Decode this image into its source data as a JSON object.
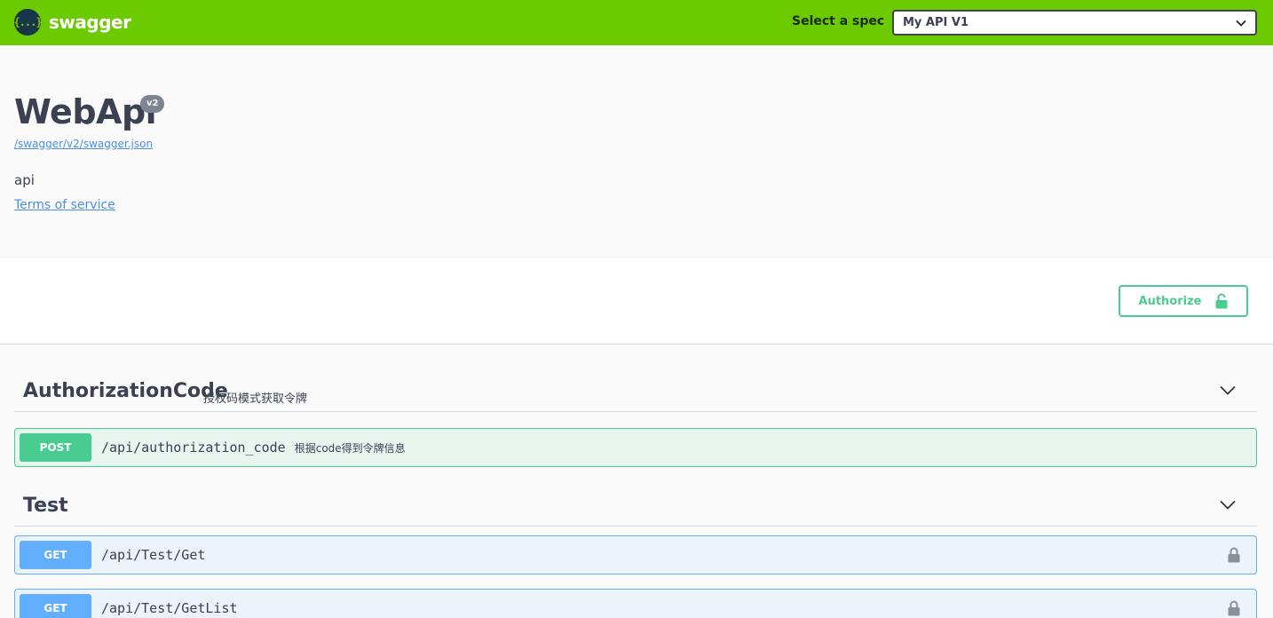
{
  "topbar": {
    "logo_glyph": "{...}",
    "logo_text": "swagger",
    "spec_label": "Select a spec",
    "spec_selected": "My API V1",
    "colors": {
      "background": "#6bca00"
    }
  },
  "info": {
    "title": "WebApi",
    "version": "v2",
    "spec_url": "/swagger/v2/swagger.json",
    "description": "api",
    "terms_link": "Terms of service"
  },
  "scheme": {
    "authorize_label": "Authorize",
    "authorize_icon": "unlocked-padlock-icon"
  },
  "tags": [
    {
      "name": "AuthorizationCode",
      "description": "授权码模式获取令牌",
      "operations": [
        {
          "method": "POST",
          "path": "/api/authorization_code",
          "summary": "根据code得到令牌信息",
          "locked": false
        }
      ]
    },
    {
      "name": "Test",
      "description": "",
      "operations": [
        {
          "method": "GET",
          "path": "/api/Test/Get",
          "summary": "",
          "locked": true
        },
        {
          "method": "GET",
          "path": "/api/Test/GetList",
          "summary": "",
          "locked": true
        }
      ]
    }
  ],
  "colors": {
    "post": "#49cc90",
    "get": "#61affe",
    "link": "#4990e2",
    "text": "#3b4151"
  }
}
